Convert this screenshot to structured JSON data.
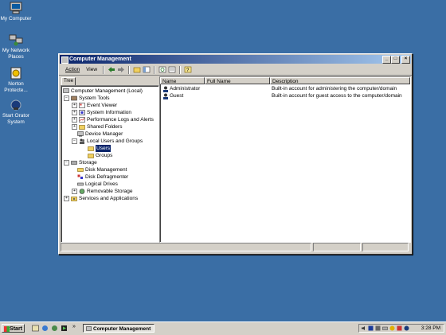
{
  "desktop": {
    "icons": [
      {
        "label": "My Computer",
        "icon": "computer-icon"
      },
      {
        "label": "My Network Places",
        "icon": "network-icon"
      },
      {
        "label": "Norton Protecte...",
        "icon": "norton-icon"
      },
      {
        "label": "Start Orator System",
        "icon": "orator-icon"
      }
    ]
  },
  "window": {
    "title": "Computer Management",
    "menu": {
      "action": "Action",
      "view": "View"
    },
    "tab": "Tree",
    "tree": [
      {
        "label": "Computer Management (Local)"
      },
      {
        "label": "System Tools"
      },
      {
        "label": "Event Viewer"
      },
      {
        "label": "System Information"
      },
      {
        "label": "Performance Logs and Alerts"
      },
      {
        "label": "Shared Folders"
      },
      {
        "label": "Device Manager"
      },
      {
        "label": "Local Users and Groups"
      },
      {
        "label": "Users"
      },
      {
        "label": "Groups"
      },
      {
        "label": "Storage"
      },
      {
        "label": "Disk Management"
      },
      {
        "label": "Disk Defragmenter"
      },
      {
        "label": "Logical Drives"
      },
      {
        "label": "Removable Storage"
      },
      {
        "label": "Services and Applications"
      }
    ],
    "list": {
      "columns": [
        "Name",
        "Full Name",
        "Description"
      ],
      "rows": [
        {
          "name": "Administrator",
          "full_name": "",
          "description": "Built-in account for administering the computer/domain"
        },
        {
          "name": "Guest",
          "full_name": "",
          "description": "Built-in account for guest access to the computer/domain"
        }
      ]
    }
  },
  "taskbar": {
    "start": "Start",
    "chevron": "»",
    "task": "Computer Management",
    "clock": "3:28 PM"
  }
}
